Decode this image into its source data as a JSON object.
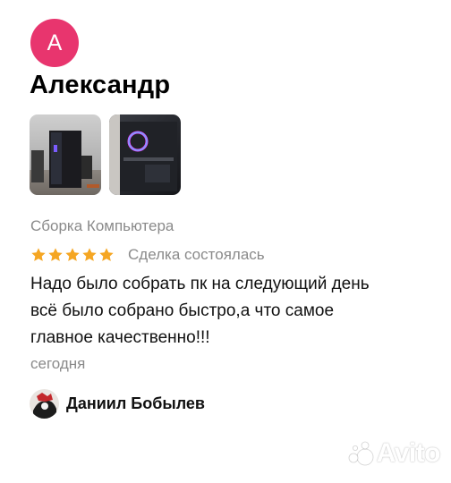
{
  "review": {
    "author_initial": "А",
    "author_name": "Александр",
    "photos": [
      "review-photo-1",
      "review-photo-2"
    ],
    "category": "Сборка Компьютера",
    "rating": 5,
    "deal_status": "Сделка состоялась",
    "text_lines": [
      "Надо было собрать пк на следующий день",
      "всё было собрано быстро,а что самое",
      "главное качественно!!!"
    ],
    "date": "сегодня"
  },
  "reply": {
    "author_name": "Даниил Бобылев"
  },
  "watermark": {
    "text": "Avito"
  },
  "colors": {
    "avatar_bg": "#e8356e",
    "star": "#f5a623",
    "secondary_text": "#8a8a8a"
  }
}
